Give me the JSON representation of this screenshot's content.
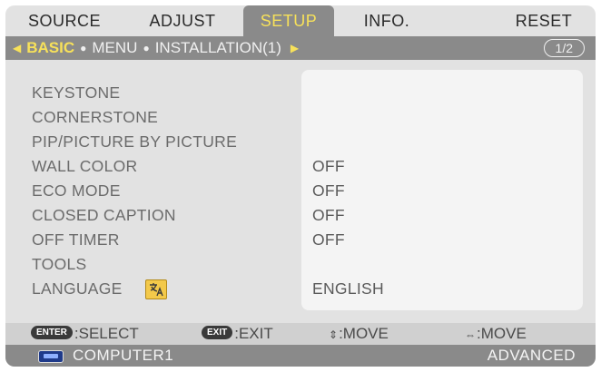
{
  "tabs": [
    {
      "label": "SOURCE",
      "active": false
    },
    {
      "label": "ADJUST",
      "active": false
    },
    {
      "label": "SETUP",
      "active": true
    },
    {
      "label": "INFO.",
      "active": false
    },
    {
      "label": "RESET",
      "active": false
    }
  ],
  "subbar": {
    "items": [
      "BASIC",
      "MENU",
      "INSTALLATION(1)"
    ],
    "page_indicator": "1/2"
  },
  "rows": [
    {
      "label": "KEYSTONE",
      "value": ""
    },
    {
      "label": "CORNERSTONE",
      "value": ""
    },
    {
      "label": "PIP/PICTURE BY PICTURE",
      "value": ""
    },
    {
      "label": "WALL COLOR",
      "value": "OFF"
    },
    {
      "label": "ECO MODE",
      "value": "OFF"
    },
    {
      "label": "CLOSED CAPTION",
      "value": "OFF"
    },
    {
      "label": "OFF TIMER",
      "value": "OFF"
    },
    {
      "label": "TOOLS",
      "value": ""
    },
    {
      "label": "LANGUAGE",
      "value": "ENGLISH"
    }
  ],
  "guide": {
    "enter_key": "ENTER",
    "enter_text": ":SELECT",
    "exit_key": "EXIT",
    "exit_text": ":EXIT",
    "move_ud_symbol": "⇕",
    "move_ud_text": ":MOVE",
    "move_lr_symbol": "⇔",
    "move_lr_text": ":MOVE"
  },
  "status": {
    "source": "COMPUTER1",
    "mode": "ADVANCED"
  },
  "colors": {
    "active_tab_text": "#f7e15a",
    "bar_gray": "#8a8a8a",
    "panel_bg": "#e2e2e2"
  },
  "icons": {
    "language": "language-icon",
    "computer": "computer-source-icon"
  }
}
